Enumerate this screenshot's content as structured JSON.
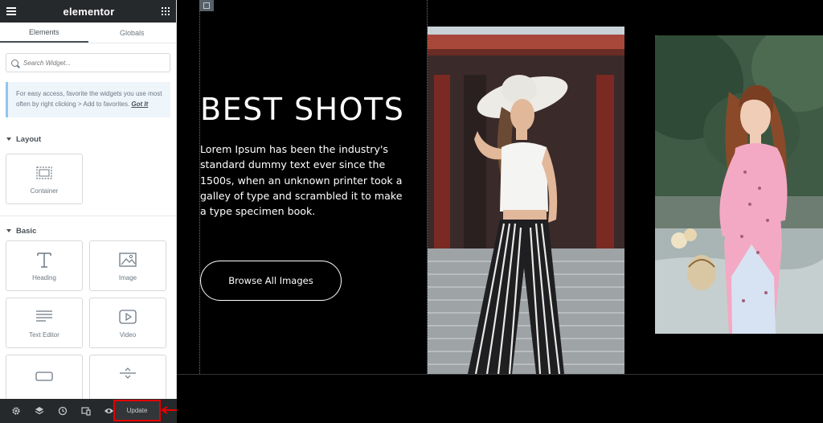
{
  "sidebar": {
    "brand": "elementor",
    "tabs": [
      {
        "label": "Elements",
        "active": true
      },
      {
        "label": "Globals",
        "active": false
      }
    ],
    "search": {
      "placeholder": "Search Widget..."
    },
    "notice": {
      "text": "For easy access, favorite the widgets you use most often by right clicking > Add to favorites.",
      "link": "Got It"
    },
    "sections": {
      "layout": {
        "title": "Layout",
        "widgets": [
          {
            "label": "Container",
            "icon": "container-icon"
          }
        ]
      },
      "basic": {
        "title": "Basic",
        "widgets": [
          {
            "label": "Heading",
            "icon": "heading-icon"
          },
          {
            "label": "Image",
            "icon": "image-icon"
          },
          {
            "label": "Text Editor",
            "icon": "text-editor-icon"
          },
          {
            "label": "Video",
            "icon": "video-icon"
          }
        ]
      }
    }
  },
  "bottombar": {
    "icons": [
      "settings-icon",
      "layers-icon",
      "history-icon",
      "responsive-icon",
      "preview-icon"
    ],
    "update_label": "Update",
    "highlight_color": "#e50000"
  },
  "canvas": {
    "headline": "BEST SHOTS",
    "paragraph": "Lorem Ipsum has been the industry's standard dummy text ever since the 1500s, when an unknown printer took a galley of type and scrambled it to make a type specimen book.",
    "button_label": "Browse All Images",
    "background": "#000000"
  },
  "colors": {
    "topbar": "#26292c",
    "accent_text": "#495157",
    "notice_border": "#93c4ea"
  }
}
